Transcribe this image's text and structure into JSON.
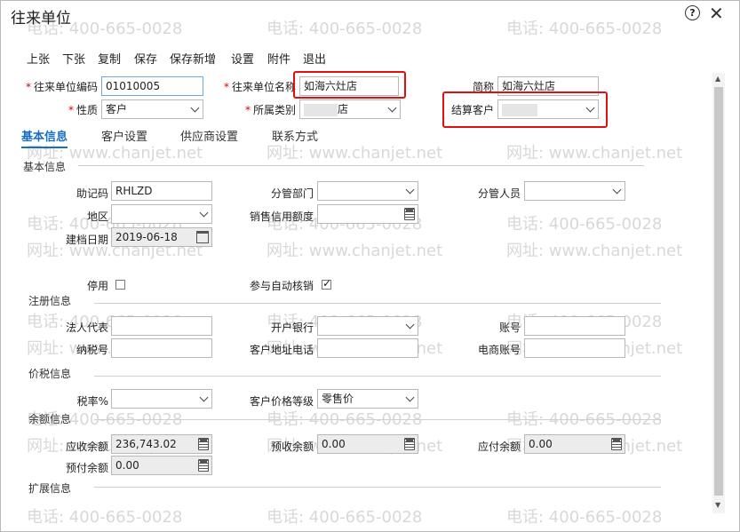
{
  "window": {
    "title": "往来单位"
  },
  "watermark": {
    "phone": "电话: 400-665-0028",
    "site": "网址: www.chanjet.net"
  },
  "toolbar": {
    "prev": "上张",
    "next": "下张",
    "copy": "复制",
    "save": "保存",
    "save_new": "保存新增",
    "settings": "设置",
    "attach": "附件",
    "exit": "退出"
  },
  "header": {
    "code_label": "往来单位编码",
    "code_value": "01010005",
    "name_label": "往来单位名称",
    "name_value": "如海六灶店",
    "short_label": "简称",
    "short_value": "如海六灶店",
    "nature_label": "性质",
    "nature_value": "客户",
    "category_label": "所属类别",
    "category_value": "店",
    "settle_label": "结算客户",
    "settle_value": ""
  },
  "tabs": [
    "基本信息",
    "客户设置",
    "供应商设置",
    "联系方式"
  ],
  "basic": {
    "section": "基本信息",
    "mnemonic_label": "助记码",
    "mnemonic_value": "RHLZD",
    "dept_label": "分管部门",
    "dept_value": "",
    "staff_label": "分管人员",
    "staff_value": "",
    "region_label": "地区",
    "region_value": "",
    "credit_label": "销售信用额度",
    "credit_value": "",
    "date_label": "建档日期",
    "date_value": "2019-06-18",
    "disabled_label": "停用",
    "auto_label": "参与自动核销"
  },
  "register": {
    "section": "注册信息",
    "legal_label": "法人代表",
    "legal_value": "",
    "bank_label": "开户银行",
    "bank_value": "",
    "account_label": "账号",
    "account_value": "",
    "tax_label": "纳税号",
    "tax_value": "",
    "addr_label": "客户地址电话",
    "addr_value": "",
    "ecom_label": "电商账号",
    "ecom_value": ""
  },
  "price": {
    "section": "价税信息",
    "rate_label": "税率%",
    "rate_value": "",
    "level_label": "客户价格等级",
    "level_value": "零售价"
  },
  "balance": {
    "section": "余额信息",
    "ar_label": "应收余额",
    "ar_value": "236,743.02",
    "pre_recv_label": "预收余额",
    "pre_recv_value": "0.00",
    "ap_label": "应付余额",
    "ap_value": "0.00",
    "pre_pay_label": "预付余额",
    "pre_pay_value": "0.00"
  },
  "ext": {
    "section": "扩展信息"
  }
}
